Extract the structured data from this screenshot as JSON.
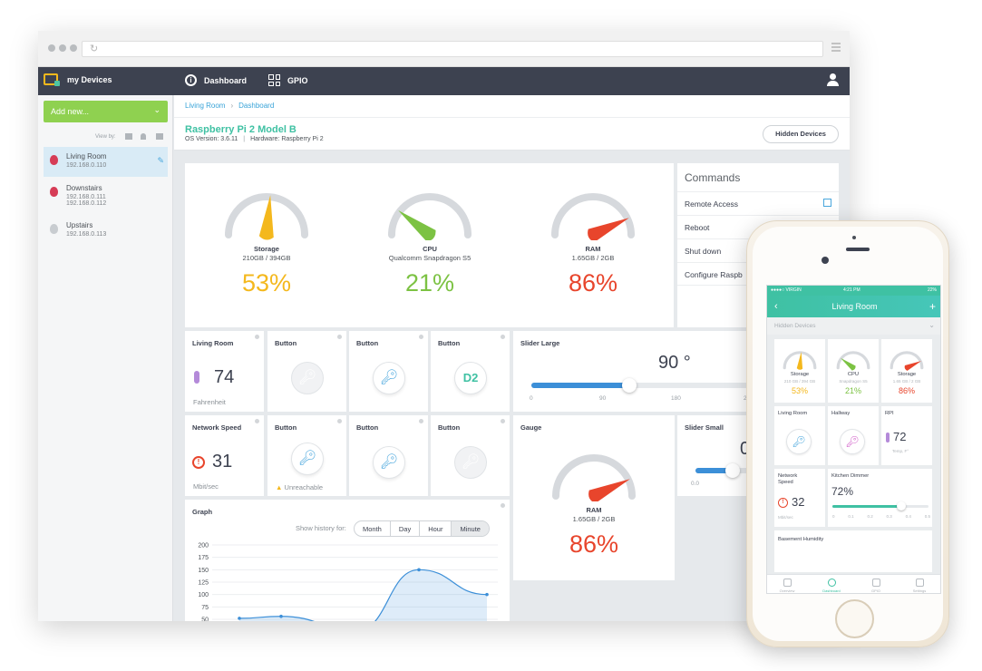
{
  "browser": {
    "brand": "my Devices",
    "nav": {
      "dashboard": "Dashboard",
      "gpio": "GPIO"
    }
  },
  "sidebar": {
    "add_new": "Add new...",
    "view_by": "View by:",
    "devices": [
      {
        "name": "Living Room",
        "ip": "192.168.0.110",
        "ip2": ""
      },
      {
        "name": "Downstairs",
        "ip": "192.168.0.111",
        "ip2": "192.168.0.112"
      },
      {
        "name": "Upstairs",
        "ip": "192.168.0.113",
        "ip2": ""
      }
    ]
  },
  "header": {
    "breadcrumb": [
      "Living Room",
      "Dashboard"
    ],
    "title": "Raspberry Pi 2 Model B",
    "os_version": "OS Version: 3.6.11",
    "hardware": "Hardware: Raspberry Pi 2",
    "hidden_devices": "Hidden Devices"
  },
  "gauges": [
    {
      "label": "Storage",
      "sub": "210GB / 394GB",
      "pct": "53%",
      "value": 0.53,
      "color": "#f4b81d"
    },
    {
      "label": "CPU",
      "sub": "Qualcomm Snapdragon S5",
      "pct": "21%",
      "value": 0.21,
      "color": "#7cc243"
    },
    {
      "label": "RAM",
      "sub": "1.65GB / 2GB",
      "pct": "86%",
      "value": 0.86,
      "color": "#e8452c"
    }
  ],
  "commands": {
    "title": "Commands",
    "items": [
      "Remote Access",
      "Reboot",
      "Shut down",
      "Configure Raspb"
    ]
  },
  "widgets": {
    "living_room": {
      "title": "Living Room",
      "value": "74",
      "unit": "Fahrenheit"
    },
    "network": {
      "title": "Network Speed",
      "value": "31",
      "unit": "Mbit/sec"
    },
    "button_label": "Button",
    "d2": "D2",
    "unreachable": "Unreachable",
    "slider_large": {
      "title": "Slider Large",
      "value": "90 °",
      "level": 0.45,
      "ticks": [
        "0",
        "90",
        "180",
        "2"
      ]
    },
    "gauge": {
      "title": "Gauge",
      "label": "RAM",
      "sub": "1.65GB / 2GB",
      "pct": "86%",
      "value": 0.86
    },
    "slider_small": {
      "title": "Slider Small",
      "value": "0",
      "level": 0.45,
      "tick0": "0.0"
    },
    "graph": {
      "title": "Graph",
      "history_label": "Show history for:",
      "ranges": [
        "Month",
        "Day",
        "Hour",
        "Minute"
      ]
    }
  },
  "chart_data": {
    "type": "area",
    "title": "Graph",
    "yticks": [
      "200",
      "175",
      "150",
      "125",
      "100",
      "75",
      "50"
    ],
    "ylim": [
      50,
      200
    ]
  },
  "phone": {
    "status": {
      "carrier": "●●●●○ VIRGIN",
      "time": "4:21 PM",
      "battery": "22%"
    },
    "title": "Living Room",
    "hidden_devices": "Hidden Devices",
    "gauges": [
      {
        "label": "Storage",
        "sub": "210 GB / 394 GB",
        "pct": "53%",
        "value": 0.53,
        "color": "#f4b81d"
      },
      {
        "label": "CPU",
        "sub": "Snapdragon S5",
        "pct": "21%",
        "value": 0.21,
        "color": "#7cc243"
      },
      {
        "label": "Storage",
        "sub": "1.65 GB / 2 GB",
        "pct": "86%",
        "value": 0.86,
        "color": "#e8452c"
      }
    ],
    "tiles": {
      "living_room": "Living Room",
      "hallway": "Hallway",
      "rpi": "RPI",
      "rpi_value": "72",
      "rpi_unit": "Temp, F°",
      "network": "Network Speed",
      "network_value": "32",
      "network_unit": "Mbit/sec",
      "dimmer": "Kitchen Dimmer",
      "dimmer_value": "72%",
      "dimmer_level": 0.72,
      "dimmer_ticks": [
        "0",
        "0.1",
        "0.2",
        "0.3",
        "0.4",
        "0.5"
      ],
      "humidity": "Basement Humidity"
    },
    "tabs": [
      "Overview",
      "Dashboard",
      "GPIO",
      "Settings"
    ]
  }
}
